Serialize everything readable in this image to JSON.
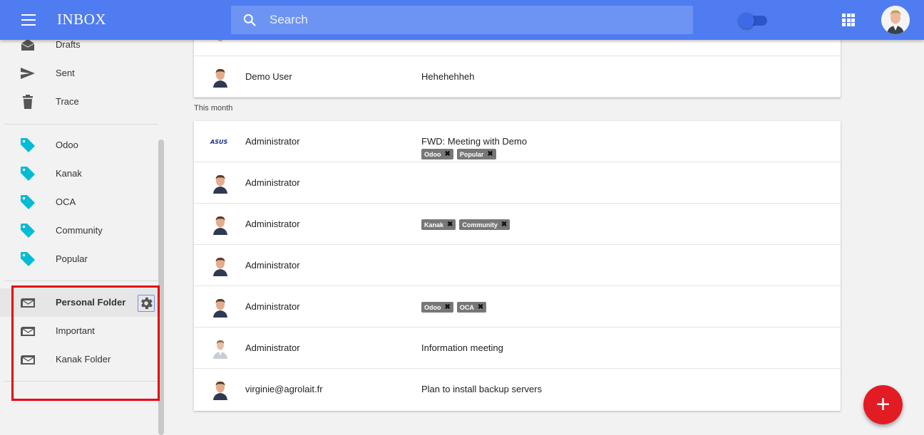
{
  "header": {
    "title": "INBOX",
    "search_placeholder": "Search"
  },
  "sidebar": {
    "folders": [
      {
        "label": "Drafts",
        "icon": "drafts-icon"
      },
      {
        "label": "Sent",
        "icon": "send-icon"
      },
      {
        "label": "Trace",
        "icon": "trash-icon"
      }
    ],
    "tags": [
      {
        "label": "Odoo",
        "icon": "tag-icon"
      },
      {
        "label": "Kanak",
        "icon": "tag-icon"
      },
      {
        "label": "OCA",
        "icon": "tag-icon"
      },
      {
        "label": "Community",
        "icon": "tag-icon"
      },
      {
        "label": "Popular",
        "icon": "tag-icon"
      }
    ],
    "custom_folders": [
      {
        "label": "Personal Folder",
        "icon": "mail-folder-icon",
        "active": true
      },
      {
        "label": "Important",
        "icon": "mail-folder-icon"
      },
      {
        "label": "Kanak Folder",
        "icon": "mail-folder-icon"
      }
    ]
  },
  "mail": {
    "earlier": [
      {
        "from": "Demo User",
        "subject": "Hehehehheh"
      }
    ],
    "section_label": "This month",
    "this_month": [
      {
        "from": "Administrator",
        "subject": "FWD: Meeting with Demo",
        "tags": [
          "Odoo",
          "Popular"
        ],
        "avatar": "asus-logo"
      },
      {
        "from": "Administrator",
        "subject": "",
        "tags": []
      },
      {
        "from": "Administrator",
        "subject": "",
        "tags": [
          "Kanak",
          "Community"
        ]
      },
      {
        "from": "Administrator",
        "subject": "",
        "tags": []
      },
      {
        "from": "Administrator",
        "subject": "",
        "tags": [
          "Odoo",
          "OCA"
        ]
      },
      {
        "from": "Administrator",
        "subject": "Information meeting",
        "tags": []
      },
      {
        "from": "virginie@agrolait.fr",
        "subject": "Plan to install backup servers",
        "tags": []
      }
    ]
  },
  "colors": {
    "topbar": "#4f7cf0",
    "tag_icon": "#00bcd4",
    "fab": "#e31b23",
    "highlight": "#e8000d"
  },
  "fab_label": "+"
}
